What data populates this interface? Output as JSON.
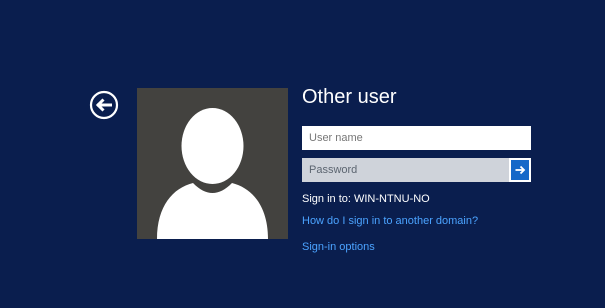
{
  "login": {
    "title": "Other user",
    "username_placeholder": "User name",
    "password_placeholder": "Password",
    "sign_in_to_label": "Sign in to:",
    "computer_name": "WIN-NTNU-NO",
    "sign_in_to_text": "Sign in to: WIN-NTNU-NO",
    "domain_help_link": "How do I sign in to another domain?",
    "sign_in_options_link": "Sign-in options"
  },
  "icons": {
    "back": "back-arrow-icon",
    "submit": "right-arrow-icon",
    "avatar": "user-silhouette-icon"
  },
  "colors": {
    "background": "#0a1e4e",
    "avatar_bg": "#43423f",
    "submit_button": "#1668c8",
    "link": "#4ba3ff",
    "password_field": "#cfd3da"
  }
}
